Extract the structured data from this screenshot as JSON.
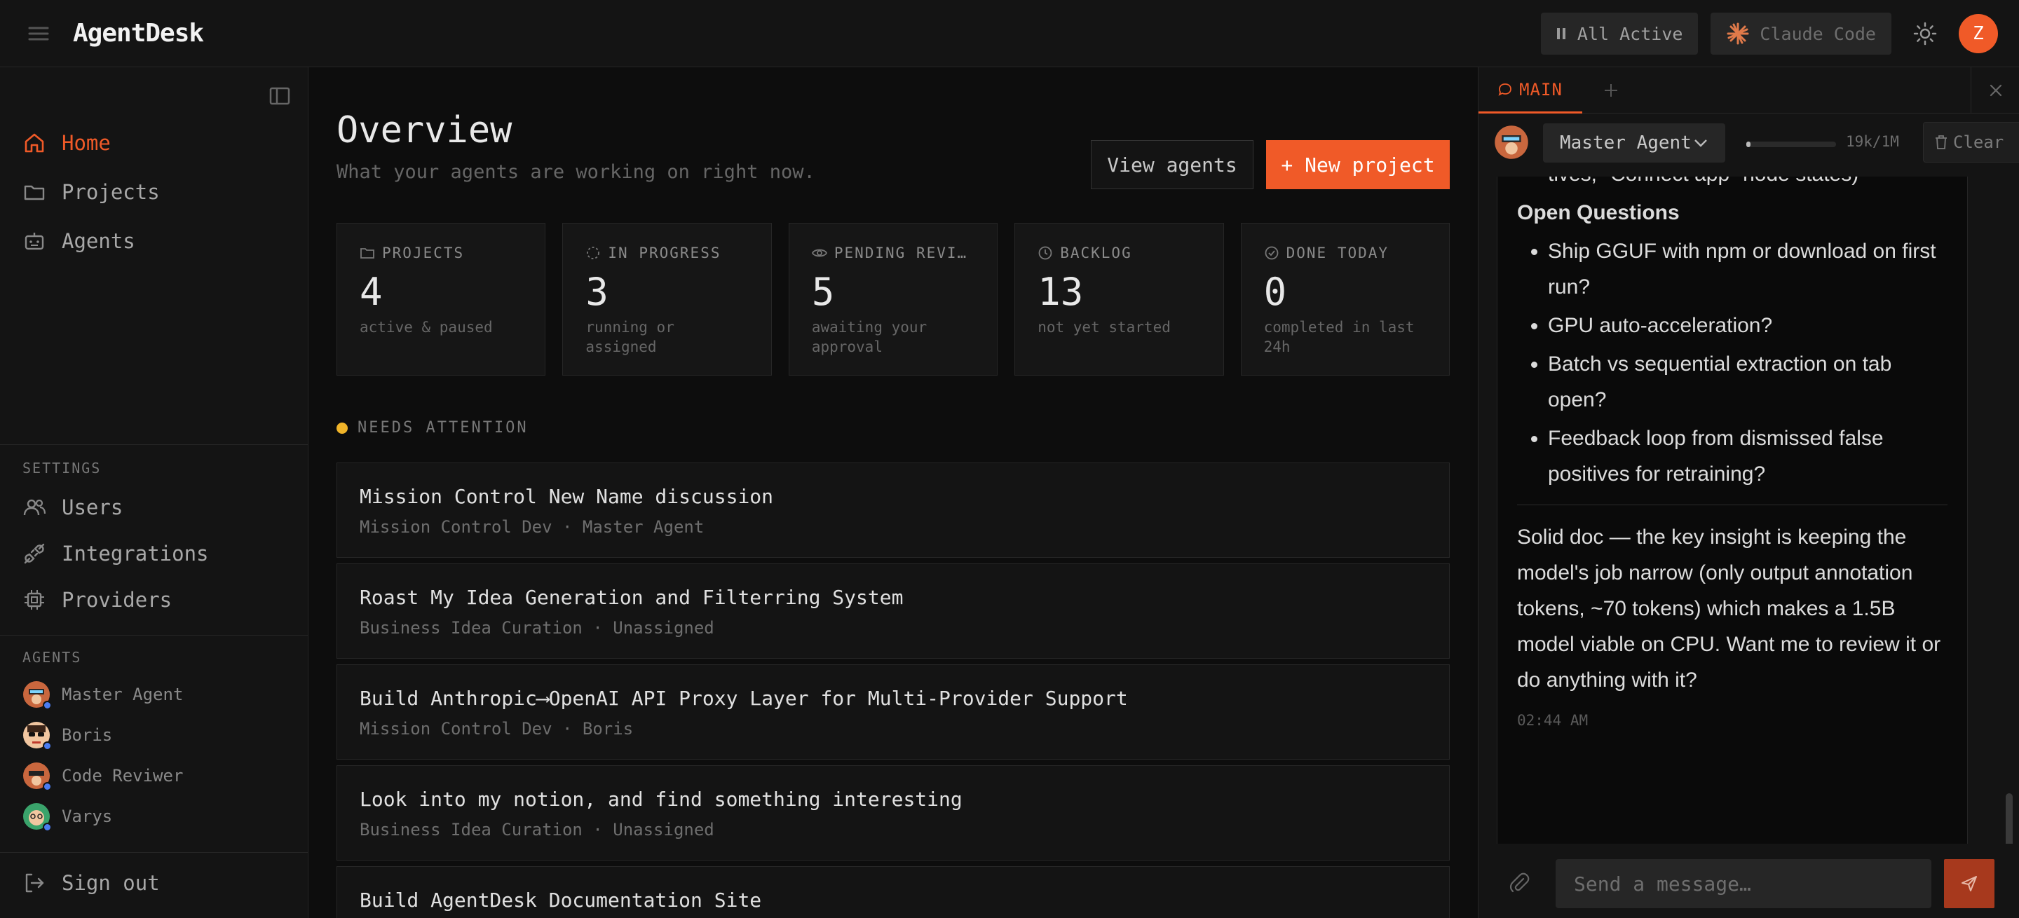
{
  "app": {
    "name": "AgentDesk"
  },
  "topbar": {
    "status_pill": "All Active",
    "provider_pill": "Claude Code",
    "user_initial": "Z"
  },
  "sidebar": {
    "nav": [
      {
        "label": "Home",
        "icon": "home-icon",
        "active": true
      },
      {
        "label": "Projects",
        "icon": "folder-icon",
        "active": false
      },
      {
        "label": "Agents",
        "icon": "bot-icon",
        "active": false
      }
    ],
    "settings_label": "SETTINGS",
    "settings": [
      {
        "label": "Users",
        "icon": "users-icon"
      },
      {
        "label": "Integrations",
        "icon": "plug-icon"
      },
      {
        "label": "Providers",
        "icon": "chip-icon"
      }
    ],
    "agents_label": "AGENTS",
    "agents": [
      {
        "name": "Master Agent"
      },
      {
        "name": "Boris"
      },
      {
        "name": "Code Reviwer"
      },
      {
        "name": "Varys"
      }
    ],
    "sign_out": "Sign out"
  },
  "main": {
    "title": "Overview",
    "subtitle": "What your agents are working on right now.",
    "view_agents": "View agents",
    "new_project": "+ New project",
    "stats": [
      {
        "label": "PROJECTS",
        "icon": "folder-icon",
        "value": "4",
        "desc": "active & paused"
      },
      {
        "label": "IN PROGRESS",
        "icon": "loader-icon",
        "value": "3",
        "desc": "running or assigned"
      },
      {
        "label": "PENDING REVI…",
        "icon": "eye-icon",
        "value": "5",
        "desc": "awaiting your approval"
      },
      {
        "label": "BACKLOG",
        "icon": "clock-icon",
        "value": "13",
        "desc": "not yet started"
      },
      {
        "label": "DONE TODAY",
        "icon": "check-circle-icon",
        "value": "0",
        "desc": "completed in last 24h"
      }
    ],
    "attention_label": "NEEDS ATTENTION",
    "tasks": [
      {
        "title": "Mission Control New Name discussion",
        "project": "Mission Control Dev",
        "agent": "Master Agent"
      },
      {
        "title": "Roast My Idea Generation and Filterring System",
        "project": "Business Idea Curation",
        "agent": "Unassigned"
      },
      {
        "title": "Build Anthropic⟶OpenAI API Proxy Layer for Multi-Provider Support",
        "project": "Mission Control Dev",
        "agent": "Boris"
      },
      {
        "title": "Look into my notion, and find something interesting",
        "project": "Business Idea Curation",
        "agent": "Unassigned"
      },
      {
        "title": "Build AgentDesk Documentation Site",
        "project": "",
        "agent": ""
      }
    ]
  },
  "panel": {
    "tab_main": "MAIN",
    "agent_name": "Master Agent",
    "token_text": "19k/1M",
    "token_fraction": 0.02,
    "clear_label": "Clear",
    "message": {
      "partial_line": "tives, \"Connect app\" node states)",
      "heading": "Open Questions",
      "bullets": [
        "Ship GGUF with npm or download on first run?",
        "GPU auto-acceleration?",
        "Batch vs sequential extraction on tab open?",
        "Feedback loop from dismissed false positives for retraining?"
      ],
      "summary": "Solid doc — the key insight is keeping the model's job narrow (only output annotation tokens, ~70 tokens) which makes a 1.5B model viable on CPU. Want me to review it or do anything with it?",
      "time": "02:44 AM"
    },
    "input_placeholder": "Send a message…"
  },
  "colors": {
    "accent": "#f05a28",
    "attention": "#f0b429",
    "status_dot": "#4a7cf0"
  }
}
